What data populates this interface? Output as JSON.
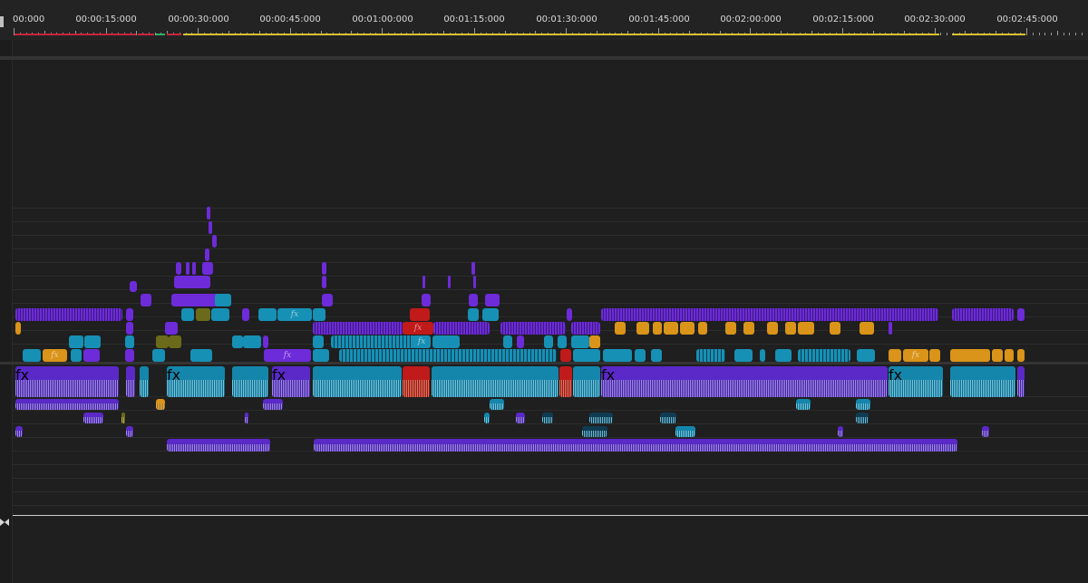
{
  "timeline": {
    "ruler": {
      "timecodes": [
        "00:000",
        "00:00:15:000",
        "00:00:30:000",
        "00:00:45:000",
        "00:01:00:000",
        "00:01:15:000",
        "00:01:30:000",
        "00:01:45:000",
        "00:02:00:000",
        "00:02:15:000",
        "00:02:30:000",
        "00:02:45:000"
      ]
    },
    "clip_label": "fx",
    "colors": {
      "background": "#1f1f1f",
      "ruler": "#232323",
      "video_purple": "#6d2bd9",
      "video_cyan": "#1790b5",
      "video_orange": "#d99419",
      "video_red": "#c01a1a",
      "video_olive": "#6b6a1a",
      "audio_purple": "#5a29c8",
      "audio_cyan": "#1486ab",
      "audio_salmon": "#e78a6a",
      "work_area_yellow": "#d9c12e",
      "work_area_red": "#c8243a",
      "work_area_green": "#29b364"
    },
    "icons": {
      "playhead_handle": "bow-tie-icon"
    }
  }
}
